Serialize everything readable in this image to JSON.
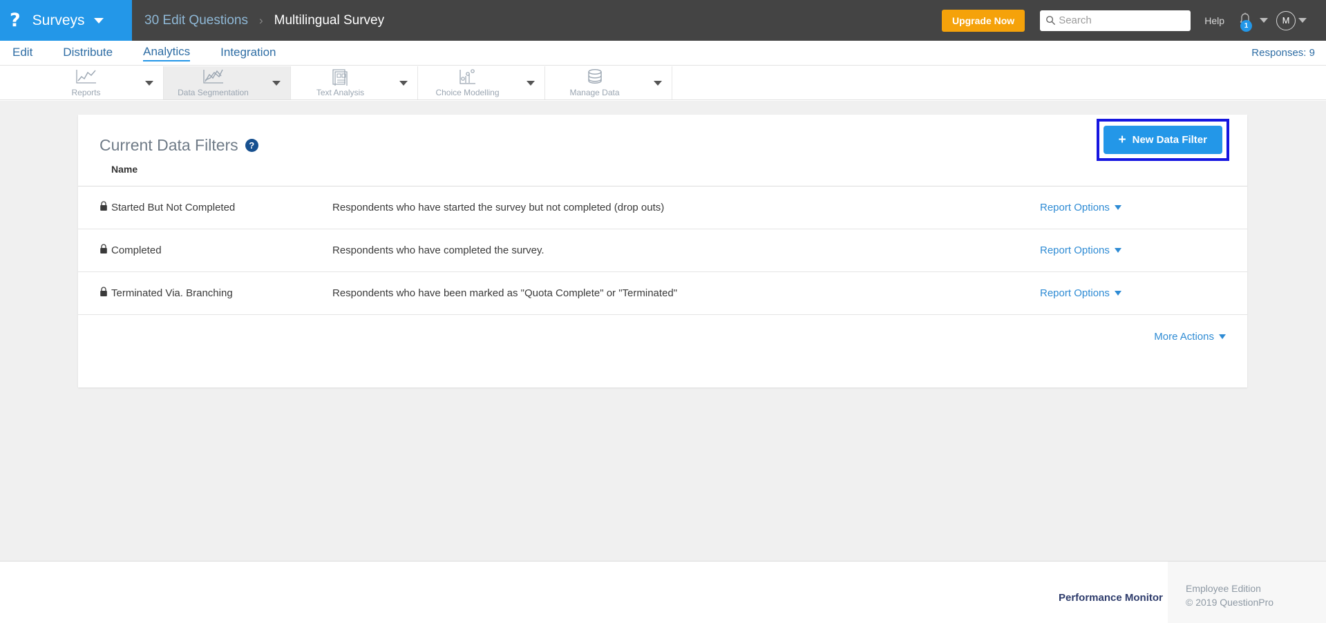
{
  "topbar": {
    "logo_mark": "?",
    "logo_text": "Surveys",
    "breadcrumb_link": "30 Edit Questions",
    "breadcrumb_sep": "›",
    "breadcrumb_current": "Multilingual Survey",
    "upgrade_label": "Upgrade Now",
    "search_placeholder": "Search",
    "search_value": "",
    "help_label": "Help",
    "notification_count": "1",
    "avatar_initial": "M",
    "brand_color": "#2397e8",
    "upgrade_color": "#f5a20a"
  },
  "tabnav": {
    "tabs": [
      {
        "label": "Edit",
        "active": false
      },
      {
        "label": "Distribute",
        "active": false
      },
      {
        "label": "Analytics",
        "active": true
      },
      {
        "label": "Integration",
        "active": false
      }
    ],
    "responses": "Responses: 9"
  },
  "toolbar": {
    "groups": [
      {
        "label": "Reports",
        "icon": "line-chart-icon",
        "active": false
      },
      {
        "label": "Data Segmentation",
        "icon": "segmentation-chart-icon",
        "active": true
      },
      {
        "label": "Text Analysis",
        "icon": "document-grid-icon",
        "active": false
      },
      {
        "label": "Choice Modelling",
        "icon": "scatter-bar-icon",
        "active": false
      },
      {
        "label": "Manage Data",
        "icon": "database-icon",
        "active": false
      }
    ]
  },
  "card": {
    "title": "Current Data Filters",
    "help_badge": "?",
    "new_filter_label": "New Data Filter",
    "new_filter_plus": "+",
    "highlight_color": "#1616e0",
    "columns": [
      "",
      "Name",
      "",
      ""
    ],
    "name_header": "Name",
    "rows": [
      {
        "lock": "lock-icon",
        "name": "Started But Not Completed",
        "description": "Respondents who have started the survey but not completed (drop outs)",
        "options_label": "Report Options"
      },
      {
        "lock": "lock-icon",
        "name": "Completed",
        "description": "Respondents who have completed the survey.",
        "options_label": "Report Options"
      },
      {
        "lock": "lock-icon",
        "name": "Terminated Via. Branching",
        "description": "Respondents who have been marked as \"Quota Complete\" or \"Terminated\"",
        "options_label": "Report Options"
      }
    ],
    "more_actions": "More Actions"
  },
  "footer": {
    "performance_monitor": "Performance Monitor",
    "edition": "Employee Edition",
    "copyright": "© 2019 QuestionPro"
  }
}
